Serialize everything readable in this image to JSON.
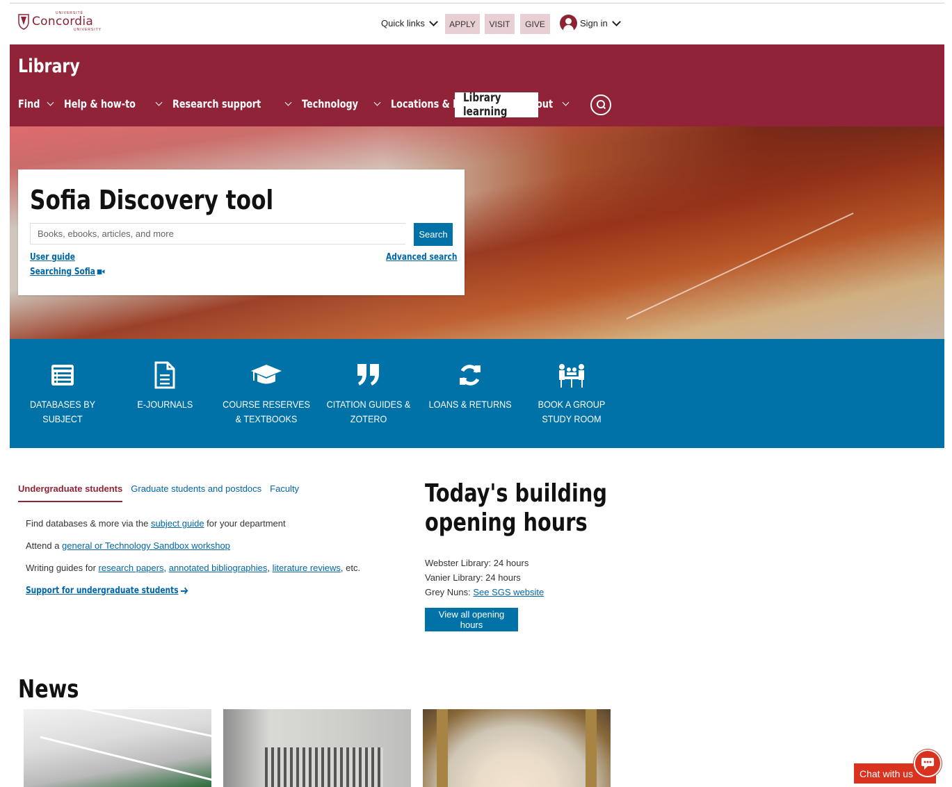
{
  "brand": {
    "name": "Concordia",
    "top_text": "UNIVERSITÉ",
    "bottom_text": "UNIVERSITY",
    "color": "#912338"
  },
  "utility": {
    "quick_links": "Quick links",
    "apply": "APPLY",
    "visit": "VISIT",
    "give": "GIVE",
    "sign_in": "Sign in"
  },
  "library": {
    "title": "Library",
    "nav": [
      {
        "label": "Find"
      },
      {
        "label": "Help & how-to"
      },
      {
        "label": "Research support"
      },
      {
        "label": "Technology"
      },
      {
        "label": "Locations & hours"
      },
      {
        "label": "About"
      }
    ],
    "learning": "Library learning",
    "search_icon": "search-icon"
  },
  "sofia": {
    "title": "Sofia Discovery tool",
    "placeholder": "Books, ebooks, articles, and more",
    "search_label": "Search",
    "user_guide": "User guide",
    "advanced_search": "Advanced search",
    "searching_sofia": "Searching Sofia"
  },
  "quick_access": [
    {
      "icon": "list-icon",
      "label": "DATABASES BY SUBJECT"
    },
    {
      "icon": "document-icon",
      "label": "E-JOURNALS"
    },
    {
      "icon": "graduation-cap-icon",
      "label": "COURSE RESERVES & TEXTBOOKS"
    },
    {
      "icon": "quote-icon",
      "label": "CITATION GUIDES & ZOTERO"
    },
    {
      "icon": "refresh-icon",
      "label": "LOANS & RETURNS"
    },
    {
      "icon": "meeting-icon",
      "label": "BOOK A GROUP STUDY ROOM"
    }
  ],
  "audience_tabs": {
    "tabs": [
      "Undergraduate students",
      "Graduate students and postdocs",
      "Faculty"
    ],
    "active": "Undergraduate students",
    "line1": {
      "before": "Find databases & more via the ",
      "link": "subject guide",
      "after": " for your department"
    },
    "line2": {
      "before": "Attend a ",
      "link": "general or Technology Sandbox workshop"
    },
    "line3": {
      "before": "Writing guides for ",
      "link1": "research papers",
      "sep1": ", ",
      "link2": "annotated bibliographies",
      "sep2": ", ",
      "link3": "literature reviews",
      "after": ", etc."
    },
    "support_link": "Support for undergraduate students"
  },
  "hours": {
    "title_line1": "Today's building",
    "title_line2": "opening hours",
    "webster": "Webster Library: 24 hours",
    "vanier": "Vanier Library: 24 hours",
    "grey_nuns_label": "Grey Nuns: ",
    "grey_nuns_link": "See SGS website",
    "button": "View all opening hours"
  },
  "news": {
    "title": "News"
  },
  "chat": {
    "label": "Chat with us",
    "color": "#d9331f"
  }
}
